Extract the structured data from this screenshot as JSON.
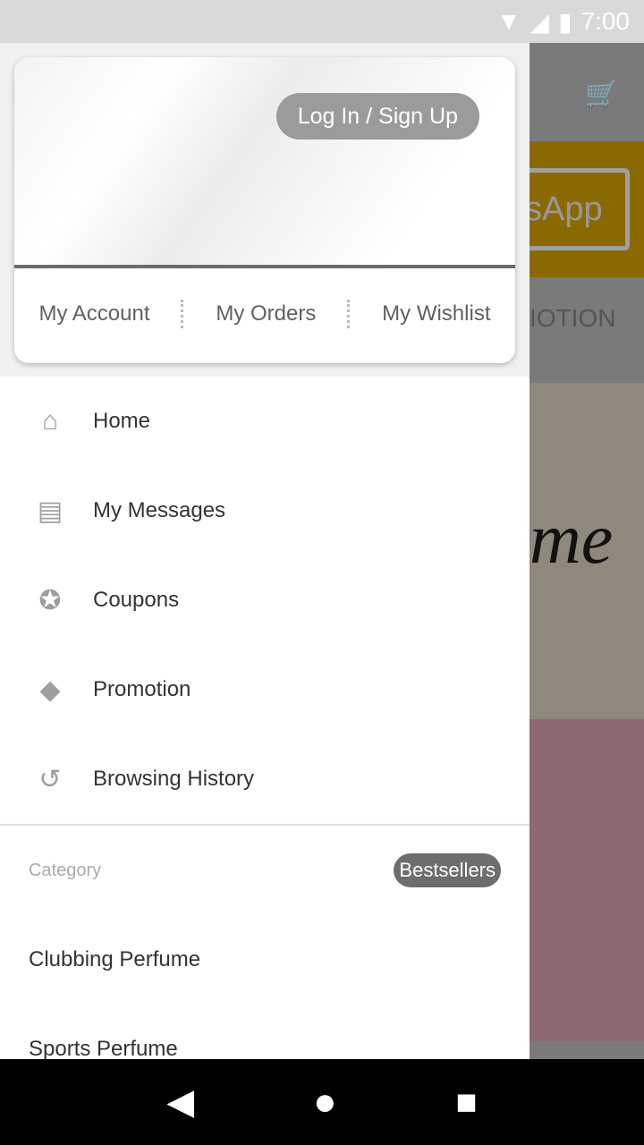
{
  "status": {
    "time": "7:00",
    "icons": [
      "wifi-icon",
      "signal-icon",
      "battery-icon"
    ]
  },
  "background": {
    "partial_button": "sApp",
    "partial_tab": "IOTION",
    "partial_script": "me"
  },
  "drawer": {
    "login_button": "Log In / Sign Up",
    "links": [
      "My Account",
      "My Orders",
      "My Wishlist"
    ],
    "menu": [
      {
        "label": "Home",
        "icon": "home-icon"
      },
      {
        "label": "My Messages",
        "icon": "message-icon"
      },
      {
        "label": "Coupons",
        "icon": "coupon-icon"
      },
      {
        "label": "Promotion",
        "icon": "tag-icon"
      },
      {
        "label": "Browsing History",
        "icon": "history-icon"
      }
    ],
    "category_title": "Category",
    "bestsellers": "Bestsellers",
    "categories": [
      "Clubbing Perfume",
      "Sports Perfume"
    ]
  }
}
